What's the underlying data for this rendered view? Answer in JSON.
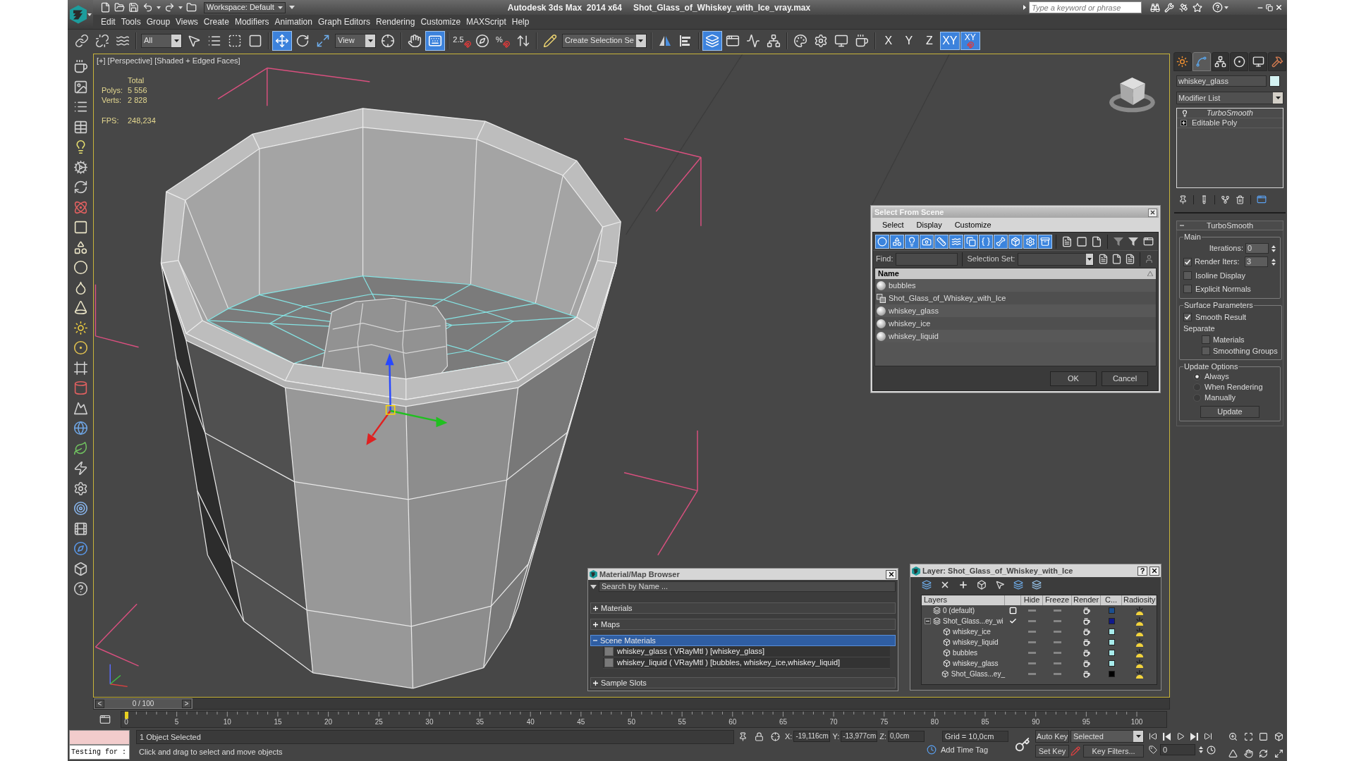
{
  "title_bar": {
    "workspace": "Workspace: Default",
    "app": "Autodesk 3ds Max  2014 x64",
    "file": "Shot_Glass_of_Whiskey_with_Ice_vray.max",
    "search": {
      "placeholder": "Type a keyword or phrase"
    }
  },
  "menu": [
    "Edit",
    "Tools",
    "Group",
    "Views",
    "Create",
    "Modifiers",
    "Animation",
    "Graph Editors",
    "Rendering",
    "Customize",
    "MAXScript",
    "Help"
  ],
  "main_toolbar": [
    {
      "kind": "icon",
      "selected": false
    },
    {
      "kind": "icon",
      "selected": false
    },
    {
      "kind": "icon",
      "selected": false
    },
    {
      "kind": "separator"
    },
    {
      "kind": "dropdown",
      "value": "All"
    },
    {
      "kind": "icon",
      "selected": false
    },
    {
      "kind": "icon",
      "selected": false
    },
    {
      "kind": "icon",
      "selected": false
    },
    {
      "kind": "icon",
      "selected": false
    },
    {
      "kind": "separator"
    },
    {
      "kind": "icon",
      "selected": true
    },
    {
      "kind": "icon",
      "selected": false
    },
    {
      "kind": "icon",
      "selected": false
    },
    {
      "kind": "dropdown",
      "value": "View"
    },
    {
      "kind": "icon",
      "selected": false
    },
    {
      "kind": "separator"
    },
    {
      "kind": "icon",
      "selected": false
    },
    {
      "kind": "icon",
      "selected": true
    },
    {
      "kind": "separator"
    },
    {
      "kind": "snap",
      "label": "2.5",
      "selected": false
    },
    {
      "kind": "icon",
      "selected": false
    },
    {
      "kind": "snap",
      "label": "%",
      "selected": false
    },
    {
      "kind": "icon",
      "selected": false
    },
    {
      "kind": "separator"
    },
    {
      "kind": "icon",
      "selected": false
    },
    {
      "kind": "dropdown",
      "value": "Create Selection Se"
    },
    {
      "kind": "separator"
    },
    {
      "kind": "icon",
      "selected": false
    },
    {
      "kind": "icon",
      "selected": false
    },
    {
      "kind": "separator"
    },
    {
      "kind": "icon",
      "selected": true
    },
    {
      "kind": "icon",
      "selected": false
    },
    {
      "kind": "icon",
      "selected": false
    },
    {
      "kind": "icon",
      "selected": false
    },
    {
      "kind": "separator"
    },
    {
      "kind": "icon",
      "selected": false
    },
    {
      "kind": "icon",
      "selected": false
    },
    {
      "kind": "icon",
      "selected": false
    },
    {
      "kind": "icon",
      "selected": false
    },
    {
      "kind": "separator"
    },
    {
      "kind": "axis",
      "label": "X",
      "selected": false
    },
    {
      "kind": "axis",
      "label": "Y",
      "selected": false
    },
    {
      "kind": "axis",
      "label": "Z",
      "selected": false
    },
    {
      "kind": "axis",
      "label": "XY",
      "selected": true
    },
    {
      "kind": "axis_snap",
      "label": "XY",
      "selected": true
    }
  ],
  "viewport": {
    "label": "[+] [Perspective] [Shaded + Edged Faces]",
    "active": true,
    "stats": {
      "heading": "Total",
      "rows": [
        {
          "label": "Polys:",
          "value": "5 556"
        },
        {
          "label": "Verts:",
          "value": "2 828"
        }
      ],
      "fps": {
        "label": "FPS:",
        "value": "248,234"
      }
    }
  },
  "command_panel": {
    "tabs": [
      {
        "selected": false
      },
      {
        "selected": true
      },
      {
        "selected": false
      },
      {
        "selected": false
      },
      {
        "selected": false
      },
      {
        "selected": false
      }
    ],
    "object_name": "whiskey_glass",
    "modifier_list": "Modifier List",
    "stack": [
      {
        "name": "TurboSmooth",
        "kind": "modifier",
        "instanced": true
      },
      {
        "name": "Editable Poly",
        "kind": "base_object",
        "expanded": false
      }
    ],
    "rollout": {
      "title": "TurboSmooth",
      "expanded": true,
      "groups": [
        {
          "title": "Main",
          "controls": [
            {
              "kind": "spinner",
              "label": "Iterations:",
              "value": "0"
            },
            {
              "kind": "check_spinner",
              "label": "Render Iters:",
              "value": "3",
              "checked": true
            },
            {
              "kind": "checkbox",
              "label": "Isoline Display",
              "checked": false
            },
            {
              "kind": "checkbox",
              "label": "Explicit Normals",
              "checked": false
            }
          ]
        },
        {
          "title": "Surface Parameters",
          "controls": [
            {
              "kind": "checkbox",
              "label": "Smooth Result",
              "checked": true
            },
            {
              "kind": "label",
              "label": "Separate"
            },
            {
              "kind": "sub_checkbox",
              "label": "Materials",
              "checked": false
            },
            {
              "kind": "sub_checkbox",
              "label": "Smoothing Groups",
              "checked": false
            }
          ]
        },
        {
          "title": "Update Options",
          "controls": [
            {
              "kind": "radio",
              "label": "Always",
              "selected": true
            },
            {
              "kind": "radio",
              "label": "When Rendering",
              "selected": false
            },
            {
              "kind": "radio",
              "label": "Manually",
              "selected": false
            },
            {
              "kind": "button",
              "label": "Update"
            }
          ]
        }
      ]
    }
  },
  "select_from_scene": {
    "title": "Select From Scene",
    "menu": [
      "Select",
      "Display",
      "Customize"
    ],
    "filters": [
      {
        "selected": true
      },
      {
        "selected": true
      },
      {
        "selected": true
      },
      {
        "selected": true
      },
      {
        "selected": true
      },
      {
        "selected": true
      },
      {
        "selected": true
      },
      {
        "selected": true
      },
      {
        "selected": true
      },
      {
        "selected": true
      },
      {
        "selected": true
      },
      {
        "selected": true
      }
    ],
    "find_label": "Find:",
    "selection_set_label": "Selection Set:",
    "column": "Name",
    "objects": [
      {
        "name": "bubbles",
        "kind": "geometry",
        "selected": false
      },
      {
        "name": "Shot_Glass_of_Whiskey_with_Ice",
        "kind": "group",
        "selected": false
      },
      {
        "name": "whiskey_glass",
        "kind": "geometry",
        "selected": false
      },
      {
        "name": "whiskey_ice",
        "kind": "geometry",
        "selected": false
      },
      {
        "name": "whiskey_liquid",
        "kind": "geometry",
        "selected": false
      }
    ],
    "buttons": [
      "OK",
      "Cancel"
    ]
  },
  "material_browser": {
    "title": "Material/Map Browser",
    "search": {
      "placeholder": "Search by Name ..."
    },
    "groups": [
      {
        "title": "Materials",
        "expanded": false,
        "selected": false
      },
      {
        "title": "Maps",
        "expanded": false,
        "selected": false
      },
      {
        "title": "Scene Materials",
        "expanded": true,
        "selected": true,
        "items": [
          "whiskey_glass ( VRayMtl ) [whiskey_glass]",
          "whiskey_liquid ( VRayMtl ) [bubbles, whiskey_ice,whiskey_liquid]"
        ]
      },
      {
        "title": "Sample Slots",
        "expanded": false,
        "selected": false
      }
    ]
  },
  "layer_manager": {
    "title": "Layer: Shot_Glass_of_Whiskey_with_Ice",
    "help": "?",
    "columns": [
      "Layers",
      "Hide",
      "Freeze",
      "Render",
      "C...",
      "Radiosity"
    ],
    "layers": [
      {
        "name": "0 (default)",
        "current": false,
        "color": "#1c4f8f"
      },
      {
        "name": "Shot_Glass...ey_wi",
        "current": true,
        "expanded": true,
        "color": "#101a8c",
        "children": [
          {
            "name": "whiskey_ice",
            "color": "#a8ecec"
          },
          {
            "name": "whiskey_liquid",
            "color": "#a8ecec"
          },
          {
            "name": "bubbles",
            "color": "#a8ecec"
          },
          {
            "name": "whiskey_glass",
            "color": "#a8ecec"
          },
          {
            "name": "Shot_Glass...ey_",
            "color": "#000000"
          }
        ]
      }
    ]
  },
  "time_slider": {
    "previous": "<",
    "position": "0 / 100",
    "next": ">",
    "level": 0
  },
  "track_bar": {
    "ticks": [
      "0",
      "5",
      "10",
      "15",
      "20",
      "25",
      "30",
      "35",
      "40",
      "45",
      "50",
      "55",
      "60",
      "65",
      "70",
      "75",
      "80",
      "85",
      "90",
      "95",
      "100"
    ]
  },
  "status_bar": {
    "listener": "Testing for :",
    "selection": "1 Object Selected",
    "prompt": "Click and drag to select and move objects",
    "coordinates": [
      {
        "label": "X:",
        "value": "-19,116cm"
      },
      {
        "label": "Y:",
        "value": "-13,977cm"
      },
      {
        "label": "Z:",
        "value": "0,0cm"
      }
    ],
    "grid": "Grid = 10,0cm",
    "time_tag": "Add Time Tag",
    "auto_key": {
      "label": "Auto Key",
      "on": false
    },
    "key_mode": "Selected",
    "set_key": "Set Key",
    "key_filters": "Key Filters...",
    "frame": "0"
  }
}
